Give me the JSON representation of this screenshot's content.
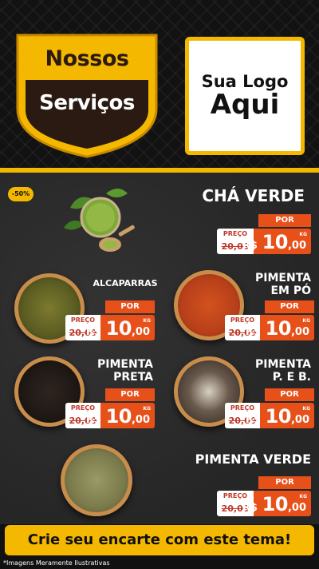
{
  "header": {
    "title_line1": "Nossos",
    "title_line2": "Serviços",
    "logo_line1": "Sua Logo",
    "logo_line2": "Aqui"
  },
  "discount_badge": "-50%",
  "price_labels": {
    "por": "POR",
    "preco": "PREÇO",
    "currency": "R$",
    "unit": "KG"
  },
  "products": [
    {
      "name": "CHÁ VERDE",
      "old_price": "20,00",
      "price_int": "10",
      "price_cents": ",00"
    },
    {
      "name": "ALCAPARRAS",
      "old_price": "20,00",
      "price_int": "10",
      "price_cents": ",00"
    },
    {
      "name_line1": "PIMENTA",
      "name_line2": "EM PÓ",
      "old_price": "20,00",
      "price_int": "10",
      "price_cents": ",00"
    },
    {
      "name_line1": "PIMENTA",
      "name_line2": "PRETA",
      "old_price": "20,00",
      "price_int": "10",
      "price_cents": ",00"
    },
    {
      "name_line1": "PIMENTA",
      "name_line2": "P. E B.",
      "old_price": "20,00",
      "price_int": "10",
      "price_cents": ",00"
    },
    {
      "name": "PIMENTA VERDE",
      "old_price": "20,00",
      "price_int": "10",
      "price_cents": ",00"
    }
  ],
  "footer": {
    "cta": "Crie seu encarte com este tema!",
    "note": "*Imagens Meramente Ilustrativas"
  },
  "colors": {
    "accent": "#f5b800",
    "price": "#e8501a",
    "dark": "#1c1c1c"
  }
}
